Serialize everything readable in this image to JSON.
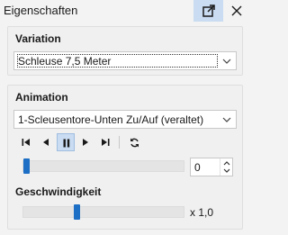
{
  "panel_title": "Eigenschaften",
  "variation": {
    "heading": "Variation",
    "selected": "Schleuse 7,5 Meter"
  },
  "animation": {
    "heading": "Animation",
    "selected": "1-Scleusentore-Unten Zu/Auf (veraltet)",
    "playback": {
      "buttons": [
        "skip-to-start",
        "step-back",
        "pause",
        "step-forward",
        "skip-to-end",
        "loop"
      ],
      "active": "pause"
    },
    "position": {
      "value": "0",
      "fraction": 0.0
    },
    "speed": {
      "heading": "Geschwindigkeit",
      "label": "x 1,0",
      "fraction": 0.33
    }
  },
  "colors": {
    "accent": "#1d6ec5",
    "active_button": "#c9dcf2"
  }
}
